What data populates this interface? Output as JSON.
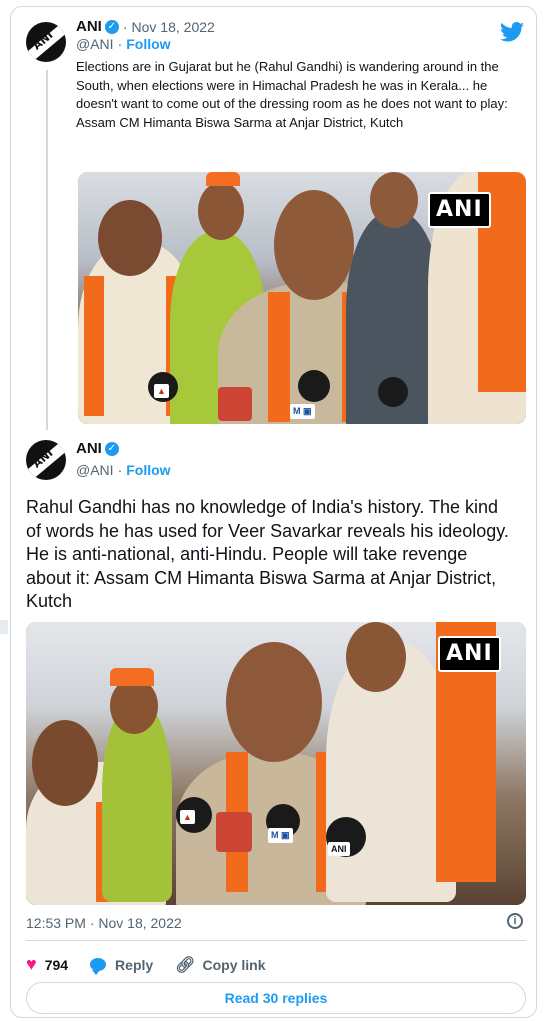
{
  "quoted_tweet": {
    "author_name": "ANI",
    "date": "Nov 18, 2022",
    "handle": "@ANI",
    "follow_label": "Follow",
    "separator": "·",
    "text": "Elections are in Gujarat but he (Rahul Gandhi) is wandering around in the South, when elections were in Himachal Pradesh he was in Kerala... he doesn't want to come out of the dressing room as he does not want to play: Assam CM Himanta Biswa Sarma at Anjar District, Kutch",
    "watermark": "ANI"
  },
  "main_tweet": {
    "author_name": "ANI",
    "handle": "@ANI",
    "follow_label": "Follow",
    "separator": "·",
    "text": "Rahul Gandhi has no knowledge of India's history. The kind of words he has used for Veer Savarkar reveals his ideology. He is anti-national, anti-Hindu. People will take revenge about it: Assam CM Himanta Biswa Sarma at Anjar District, Kutch",
    "watermark": "ANI",
    "timestamp": "12:53 PM · Nov 18, 2022",
    "likes": "794",
    "reply_label": "Reply",
    "copy_link_label": "Copy link",
    "read_replies_label": "Read 30 replies"
  },
  "colors": {
    "accent": "#1d9bf0",
    "like": "#f91880",
    "border": "#cfd9de",
    "muted": "#536471"
  },
  "icons": {
    "logo": "twitter-bird-icon",
    "verified": "verified-badge-icon",
    "like": "heart-icon",
    "reply": "speech-bubble-icon",
    "copy_link": "link-icon",
    "info": "info-icon"
  }
}
